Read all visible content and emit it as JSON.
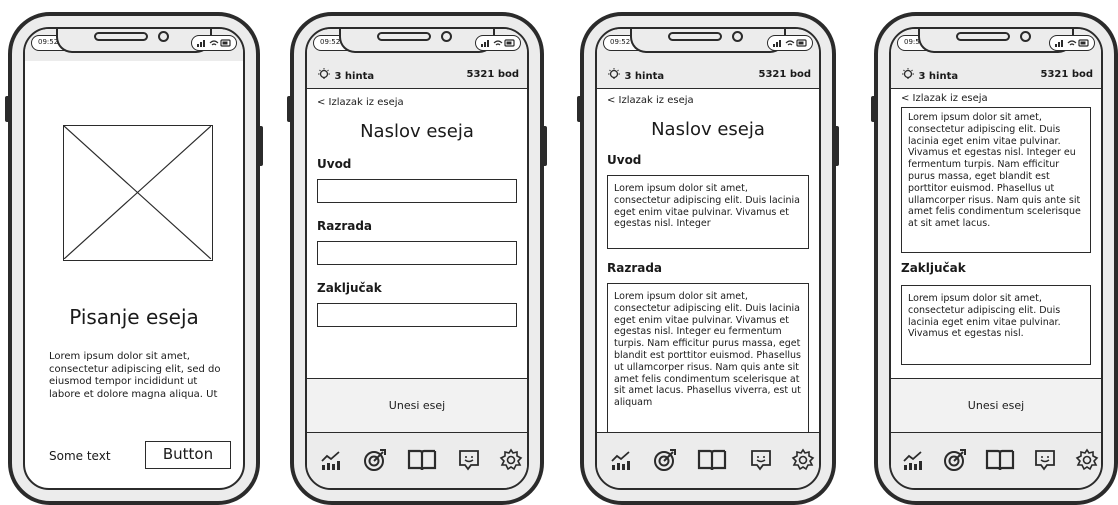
{
  "status_time": "09:52 AM",
  "header": {
    "hints": "3 hinta",
    "points": "5321 bod"
  },
  "back_label": "< Izlazak iz eseja",
  "essay_title": "Naslov eseja",
  "sections": {
    "intro": "Uvod",
    "body": "Razrada",
    "conclusion": "Zaključak"
  },
  "submit_label": "Unesi esej",
  "screen1": {
    "title": "Pisanje eseja",
    "paragraph": "Lorem ipsum dolor sit amet, consectetur adipiscing elit, sed do eiusmod tempor incididunt ut labore et dolore magna aliqua. Ut",
    "some_text": "Some text",
    "button": "Button"
  },
  "screen3": {
    "intro_text": "Lorem ipsum dolor sit amet, consectetur adipiscing elit. Duis lacinia eget enim vitae pulvinar. Vivamus et egestas nisl. Integer",
    "body_text": "Lorem ipsum dolor sit amet, consectetur adipiscing elit. Duis lacinia eget enim vitae pulvinar. Vivamus et egestas nisl. Integer eu fermentum turpis. Nam efficitur purus massa, eget blandit est porttitor euismod. Phasellus ut ullamcorper risus. Nam quis ante sit amet felis condimentum scelerisque at sit amet lacus. Phasellus viverra, est ut aliquam"
  },
  "screen4": {
    "body_text": "Lorem ipsum dolor sit amet, consectetur adipiscing elit. Duis lacinia eget enim vitae pulvinar. Vivamus et egestas nisl. Integer eu fermentum turpis. Nam efficitur purus massa, eget blandit est porttitor euismod. Phasellus ut ullamcorper risus. Nam quis ante sit amet felis condimentum scelerisque at sit amet lacus.",
    "conclusion_text": "Lorem ipsum dolor sit amet, consectetur adipiscing elit. Duis lacinia eget enim vitae pulvinar. Vivamus et egestas nisl."
  },
  "nav_icons": [
    "stats-icon",
    "target-icon",
    "book-icon",
    "chat-icon",
    "settings-icon"
  ],
  "colors": {
    "ink": "#2b2b2b",
    "frame": "#ececec",
    "paper": "#ffffff"
  }
}
